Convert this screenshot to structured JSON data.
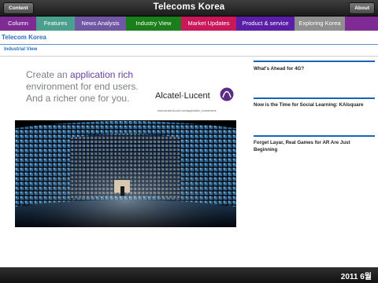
{
  "topbar": {
    "title": "Telecoms Korea",
    "left_button": "Content",
    "right_button": "About"
  },
  "nav": {
    "tabs": [
      {
        "label": "Column",
        "color": "#7e2b93"
      },
      {
        "label": "Features",
        "color": "#4aa08c"
      },
      {
        "label": "News Analysis",
        "color": "#6f57a3"
      },
      {
        "label": "Industry View",
        "color": "#1a7f1a",
        "active": true
      },
      {
        "label": "Market Updates",
        "color": "#c8185a"
      },
      {
        "label": "Product & service",
        "color": "#5a1fa6"
      },
      {
        "label": "Exploring Korea",
        "color": "#8f8f8f"
      }
    ]
  },
  "section": {
    "title": "Telecom Korea",
    "subtitle": "Industrial View"
  },
  "ad": {
    "headline_line1_pre": "Create an ",
    "headline_line1_highlight": "application rich",
    "headline_line2": "environment for end users.",
    "headline_line3": "And a richer one for you.",
    "brand": "Alcatel·Lucent",
    "url": "www.alcatel-lucent.com/application_enablement"
  },
  "articles": [
    {
      "title": "What's Ahead for 4G?"
    },
    {
      "title": "Now is the Time for Social Learning: KAIsquare"
    },
    {
      "title": "Forget Layar, Real Games for AR Are Just Beginning"
    }
  ],
  "footer": {
    "date": "2011 6월"
  }
}
